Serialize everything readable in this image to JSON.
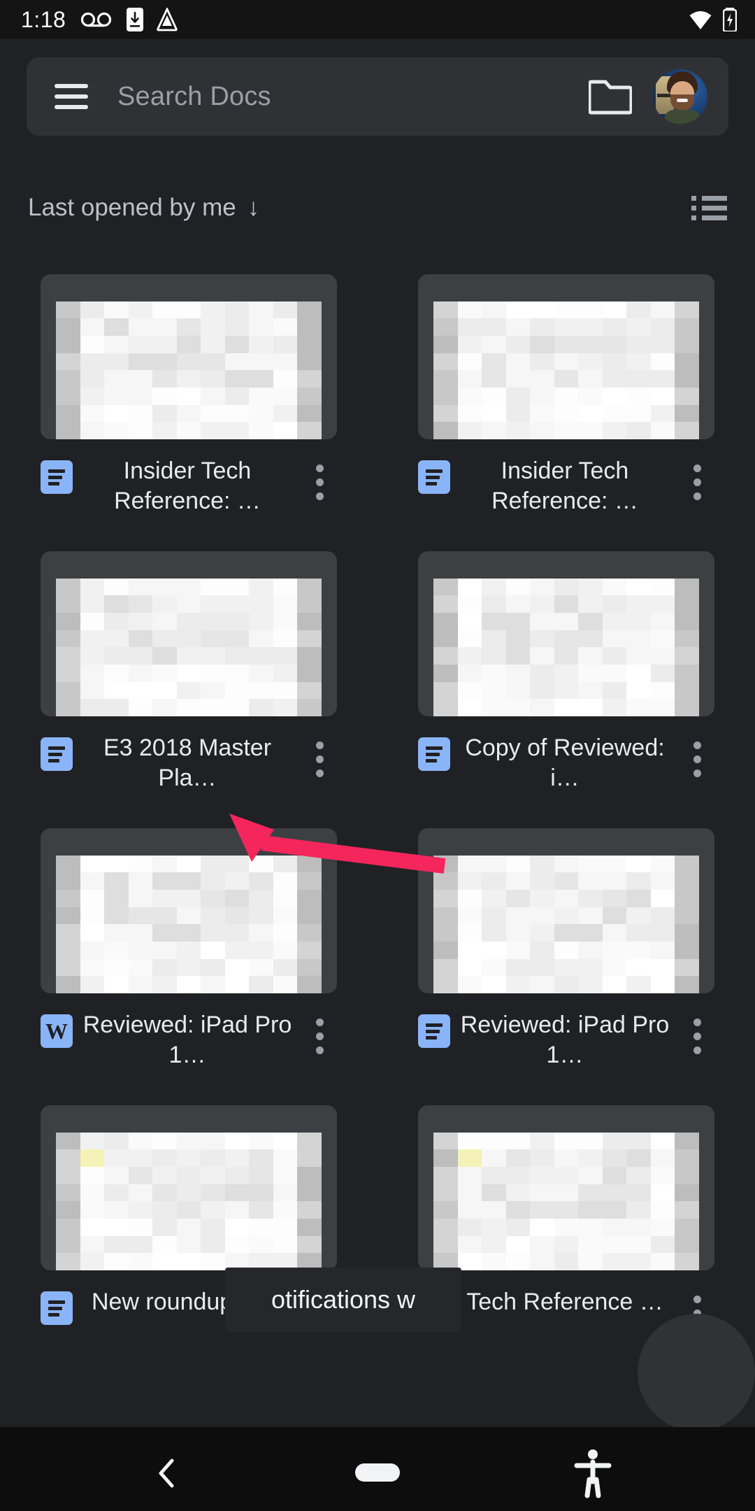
{
  "status_bar": {
    "time": "1:18",
    "icons": [
      "voicemail-icon",
      "phone-download-icon",
      "drive-triangle-icon"
    ],
    "right_icons": [
      "wifi-icon",
      "battery-charging-icon"
    ]
  },
  "search": {
    "placeholder": "Search Docs",
    "menu_icon": "hamburger-menu-icon",
    "folder_icon": "folder-icon",
    "avatar_label": "account-avatar"
  },
  "sort": {
    "label": "Last opened by me",
    "arrow": "↓",
    "view_toggle_icon": "list-view-icon"
  },
  "documents": [
    {
      "title": "Insider Tech Reference: …",
      "icon": "google-docs-icon",
      "kebab": "more-options-icon"
    },
    {
      "title": "Insider Tech Reference: …",
      "icon": "google-docs-icon",
      "kebab": "more-options-icon"
    },
    {
      "title": "E3 2018 Master Pla…",
      "icon": "google-docs-icon",
      "kebab": "more-options-icon"
    },
    {
      "title": "Copy of Reviewed: i…",
      "icon": "google-docs-icon",
      "kebab": "more-options-icon"
    },
    {
      "title": "Reviewed: iPad Pro 1…",
      "icon": "word-doc-icon",
      "kebab": "more-options-icon"
    },
    {
      "title": "Reviewed: iPad Pro 1…",
      "icon": "google-docs-icon",
      "kebab": "more-options-icon"
    },
    {
      "title": "New roundup te…",
      "icon": "google-docs-icon",
      "kebab": "more-options-icon"
    },
    {
      "title": "Tech Reference …",
      "icon": "google-docs-icon",
      "kebab": "more-options-icon"
    }
  ],
  "toast": {
    "text": "otifications w"
  },
  "nav_bar": {
    "back_icon": "back-chevron-icon",
    "home_icon": "home-pill-icon",
    "accessibility_icon": "accessibility-icon"
  },
  "annotation": {
    "arrow_color": "#F5265C",
    "points_at": "E3 2018 Master Pla… more-options-icon"
  },
  "colors": {
    "background": "#202124",
    "card": "#3c4043",
    "accent_blue": "#8ab4f8",
    "text_primary": "#e8eaed",
    "text_secondary": "#9aa0a6"
  }
}
